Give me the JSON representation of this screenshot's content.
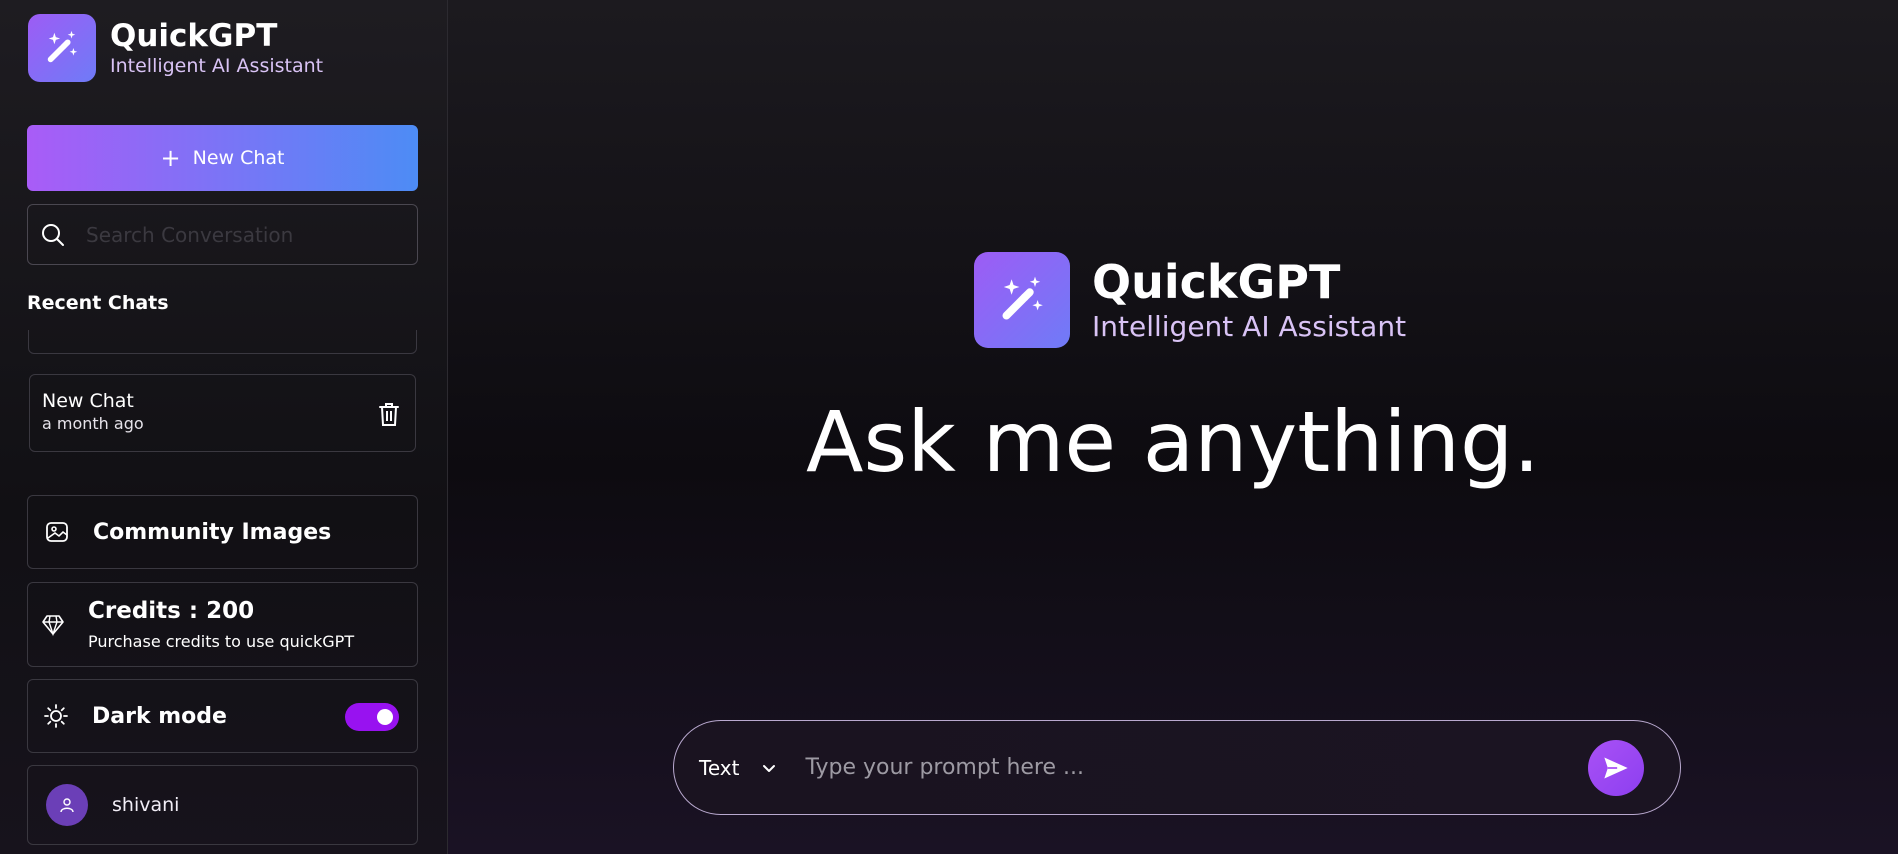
{
  "app": {
    "title": "QuickGPT",
    "subtitle": "Intelligent AI Assistant"
  },
  "sidebar": {
    "new_chat_label": "New Chat",
    "search_placeholder": "Search Conversation",
    "recent_label": "Recent Chats",
    "chats": [
      {
        "title": "New Chat",
        "time": "a month ago"
      }
    ],
    "community_label": "Community Images",
    "credits_title": "Credits : 200",
    "credits_sub": "Purchase credits to use quickGPT",
    "dark_mode_label": "Dark mode",
    "dark_mode_on": true,
    "user_name": "shivani"
  },
  "main": {
    "headline": "Ask me anything.",
    "mode_value": "Text",
    "prompt_placeholder": "Type your prompt here ..."
  },
  "colors": {
    "accent_purple": "#a95cf7",
    "accent_blue": "#4d8cf5",
    "toggle_on": "#9812f0"
  },
  "icons": [
    "magic-wand-icon",
    "plus-icon",
    "search-icon",
    "trash-icon",
    "image-icon",
    "diamond-icon",
    "sun-icon",
    "user-icon",
    "chevron-down-icon",
    "send-icon"
  ]
}
